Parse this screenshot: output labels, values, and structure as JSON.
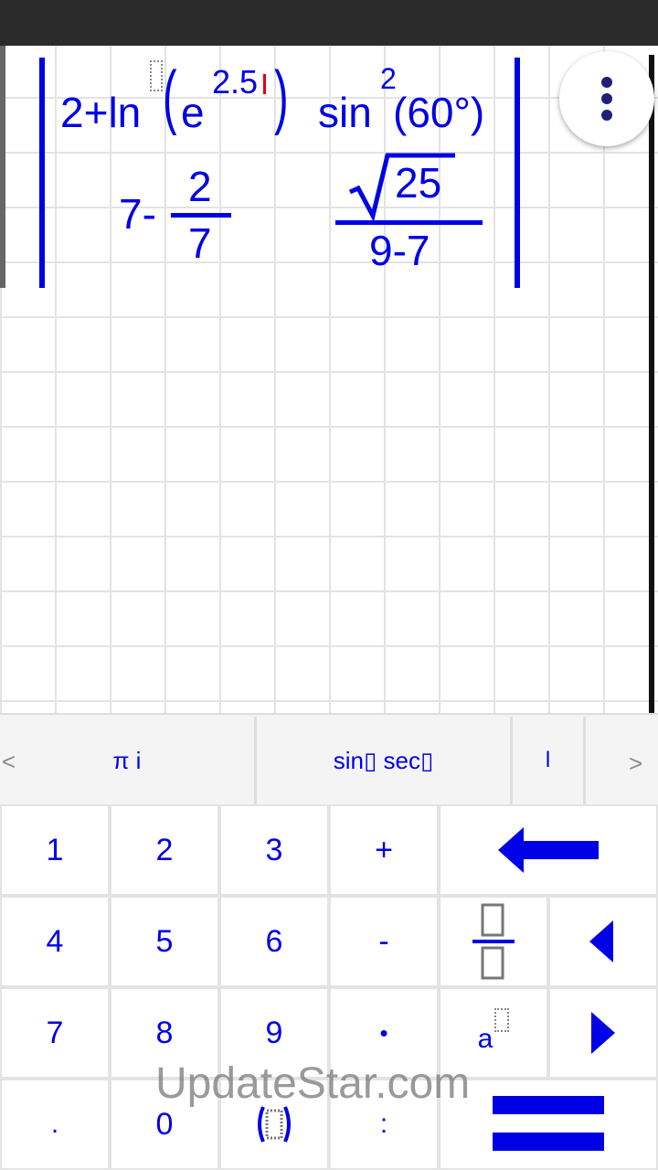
{
  "expression": {
    "row1": {
      "ln_lead": "2+ln",
      "e": "e",
      "exponent": "2.5",
      "open_paren": "(",
      "close_paren": ")",
      "sin": "sin",
      "sin_power": "2",
      "sin_arg": "(60°)"
    },
    "row2": {
      "lead": "7-",
      "numerator": "2",
      "denominator": "7",
      "sqrt_value": "25",
      "denominator2": "9-7"
    }
  },
  "function_tabs": {
    "left_arrow": "<",
    "right_arrow": ">",
    "items": [
      "π i",
      "sin▯ sec▯",
      "l"
    ]
  },
  "keys": {
    "one": "1",
    "two": "2",
    "three": "3",
    "plus": "+",
    "four": "4",
    "five": "5",
    "six": "6",
    "minus": "-",
    "seven": "7",
    "eight": "8",
    "nine": "9",
    "dot_mul": "•",
    "power": "a",
    "period": ".",
    "zero": "0",
    "colon": ":"
  },
  "watermark": "UpdateStar.com",
  "colors": {
    "accent": "#0000e6",
    "cursor": "#e00000",
    "grid": "#e3e3e3"
  }
}
